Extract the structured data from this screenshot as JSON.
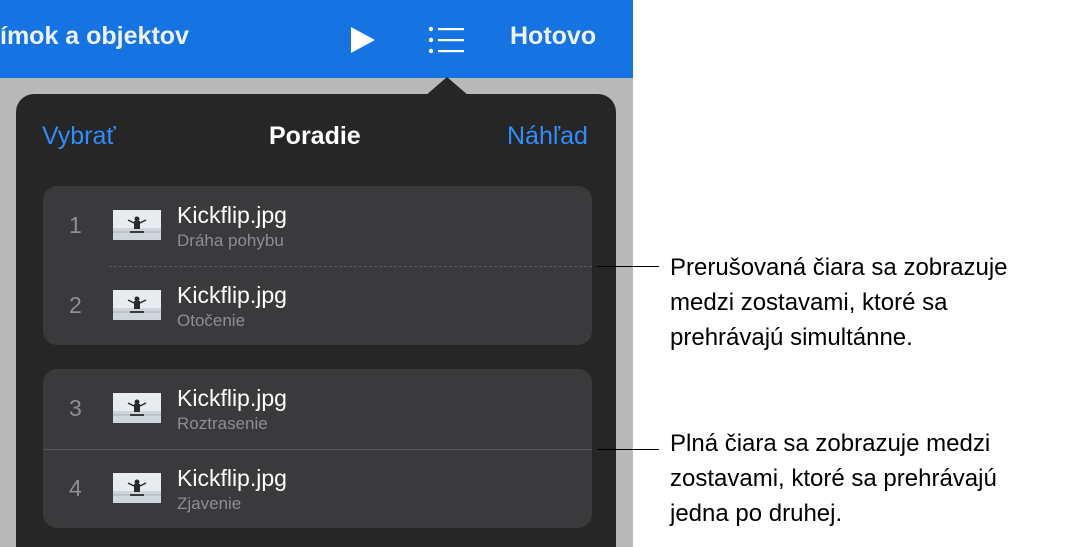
{
  "toolbar": {
    "title": "ímok a objektov",
    "play_icon": "play-icon",
    "list_icon": "list-icon",
    "done_label": "Hotovo",
    "color": "#1573e2"
  },
  "popover": {
    "select_label": "Vybrať",
    "title": "Poradie",
    "preview_label": "Náhľad",
    "background": "#262626",
    "groups": [
      {
        "separator": "dashed",
        "items": [
          {
            "number": "1",
            "file": "Kickflip.jpg",
            "effect": "Dráha pohybu"
          },
          {
            "number": "2",
            "file": "Kickflip.jpg",
            "effect": "Otočenie"
          }
        ]
      },
      {
        "separator": "solid",
        "items": [
          {
            "number": "3",
            "file": "Kickflip.jpg",
            "effect": "Roztrasenie"
          },
          {
            "number": "4",
            "file": "Kickflip.jpg",
            "effect": "Zjavenie"
          }
        ]
      }
    ]
  },
  "callouts": {
    "dashed": [
      "Prerušovaná čiara sa zobrazuje",
      "medzi zostavami, ktoré sa",
      "prehrávajú simultánne."
    ],
    "solid": [
      "Plná čiara sa zobrazuje medzi",
      "zostavami, ktoré sa prehrávajú",
      "jedna po druhej."
    ]
  }
}
